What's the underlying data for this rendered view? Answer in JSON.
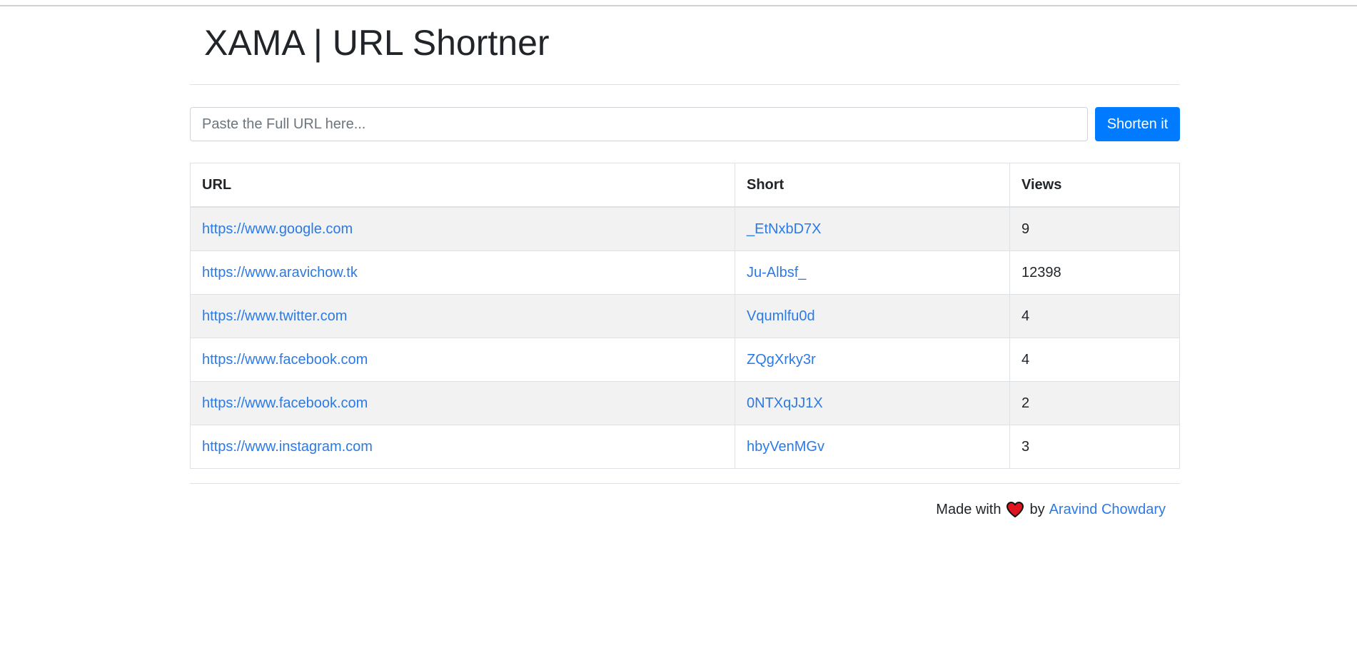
{
  "header": {
    "title": "XAMA | URL Shortner"
  },
  "form": {
    "url_placeholder": "Paste the Full URL here...",
    "url_value": "",
    "submit_label": "Shorten it"
  },
  "table": {
    "columns": [
      "URL",
      "Short",
      "Views"
    ],
    "rows": [
      {
        "url": "https://www.google.com",
        "short": "_EtNxbD7X",
        "views": "9"
      },
      {
        "url": "https://www.aravichow.tk",
        "short": "Ju-Albsf_",
        "views": "12398"
      },
      {
        "url": "https://www.twitter.com",
        "short": "Vqumlfu0d",
        "views": "4"
      },
      {
        "url": "https://www.facebook.com",
        "short": "ZQgXrky3r",
        "views": "4"
      },
      {
        "url": "https://www.facebook.com",
        "short": "0NTXqJJ1X",
        "views": "2"
      },
      {
        "url": "https://www.instagram.com",
        "short": "hbyVenMGv",
        "views": "3"
      }
    ]
  },
  "footer": {
    "made_with": "Made with",
    "icon": "heart-icon",
    "by": "by",
    "author": "Aravind Chowdary"
  },
  "colors": {
    "primary": "#007bff",
    "link": "#2b7ae5",
    "heart": "#e0141e",
    "stripe": "#f2f2f2"
  }
}
